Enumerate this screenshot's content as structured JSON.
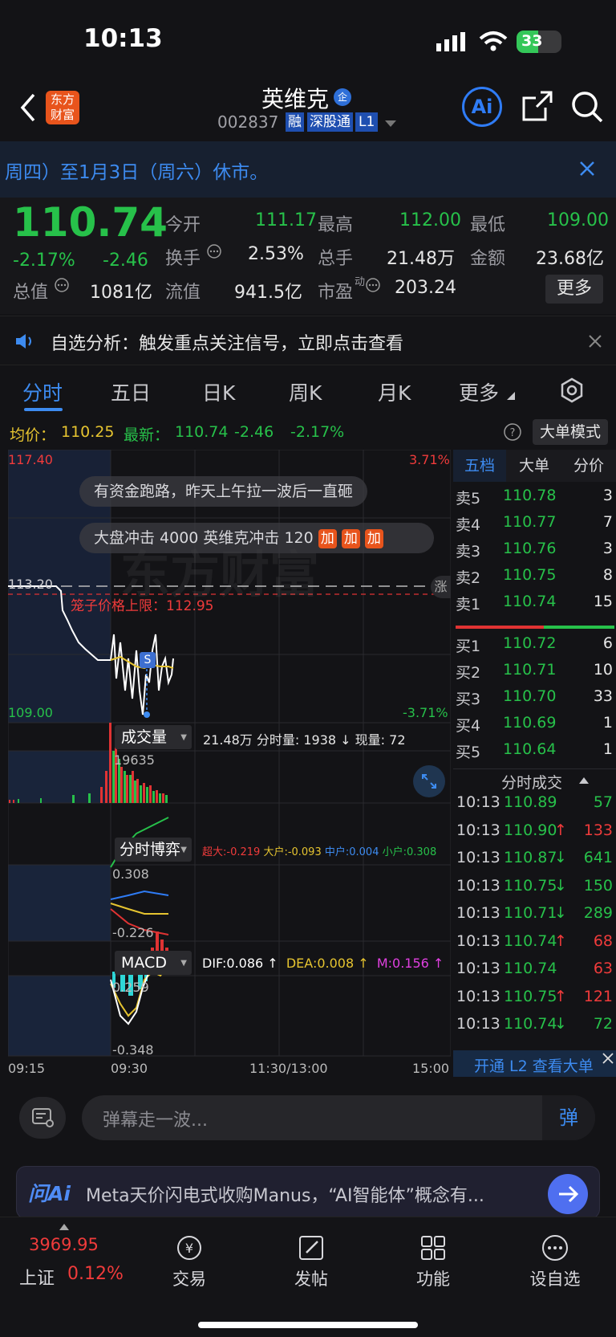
{
  "status": {
    "time": "10:13",
    "battery": "33"
  },
  "header": {
    "brand_top": "东方",
    "brand_bottom": "财富",
    "stock_name": "英维克",
    "stock_tag": "企",
    "code": "002837",
    "badges": [
      "融",
      "深股通",
      "L1"
    ]
  },
  "banner": {
    "text": "周四）至1月3日（周六）休市。"
  },
  "quote": {
    "price": "110.74",
    "pct": "-2.17%",
    "chg": "-2.46",
    "fields": [
      {
        "label": "今开",
        "value": "111.17"
      },
      {
        "label": "最高",
        "value": "112.00"
      },
      {
        "label": "最低",
        "value": "109.00"
      },
      {
        "label": "换手",
        "value": "2.53%"
      },
      {
        "label": "总手",
        "value": "21.48万"
      },
      {
        "label": "金额",
        "value": "23.68亿"
      },
      {
        "label": "总值",
        "value": "1081亿"
      },
      {
        "label": "流值",
        "value": "941.5亿"
      },
      {
        "label": "市盈",
        "value": "203.24",
        "sup": "动"
      }
    ],
    "more": "更多"
  },
  "notice": {
    "text": "自选分析：触发重点关注信号，立即点击查看"
  },
  "tabs": [
    "分时",
    "五日",
    "日K",
    "周K",
    "月K",
    "更多"
  ],
  "infobar": {
    "avg_label": "均价：",
    "avg": "110.25",
    "latest_label": "最新：",
    "latest": "110.74",
    "chg": "-2.46",
    "pct": "-2.17%",
    "mode": "大单模式"
  },
  "chart": {
    "top_price": "117.40",
    "top_pct": "3.71%",
    "mid_price": "113.20",
    "limit": "笼子价格上限：112.95",
    "bottom_price": "109.00",
    "bottom_pct": "-3.71%",
    "watermark": "东方财富",
    "mid_tag": "涨",
    "bullet1": "有资金跑路，昨天上午拉一波后一直砸",
    "bullet2": "大盘冲击 4000 英维克冲击 120",
    "bullet2_tags": [
      "加",
      "加",
      "加"
    ],
    "marker": "S"
  },
  "volume": {
    "title": "成交量",
    "stats": "21.48万 分时量: 1938 ↓ 现量: 72",
    "max": "19635"
  },
  "fund": {
    "title": "分时博弈",
    "chao": "超大:-0.219",
    "da": "大户:-0.093",
    "zhong": "中户:0.004",
    "xiao": "小户:0.308",
    "top": "0.308",
    "bottom": "-0.226"
  },
  "macd": {
    "title": "MACD",
    "dif": "DIF:0.086 ↑",
    "dea": "DEA:0.008 ↑",
    "m": "M:0.156 ↑",
    "top": "0.259",
    "bottom": "-0.348"
  },
  "xaxis": [
    "09:15",
    "09:30",
    "11:30/13:00",
    "15:00"
  ],
  "orderbook": {
    "tabs": [
      "五档",
      "大单",
      "分价"
    ],
    "asks": [
      {
        "l": "卖5",
        "p": "110.78",
        "v": "3"
      },
      {
        "l": "卖4",
        "p": "110.77",
        "v": "7"
      },
      {
        "l": "卖3",
        "p": "110.76",
        "v": "3"
      },
      {
        "l": "卖2",
        "p": "110.75",
        "v": "8"
      },
      {
        "l": "卖1",
        "p": "110.74",
        "v": "15"
      }
    ],
    "bids": [
      {
        "l": "买1",
        "p": "110.72",
        "v": "6"
      },
      {
        "l": "买2",
        "p": "110.71",
        "v": "10"
      },
      {
        "l": "买3",
        "p": "110.70",
        "v": "33"
      },
      {
        "l": "买4",
        "p": "110.69",
        "v": "1"
      },
      {
        "l": "买5",
        "p": "110.64",
        "v": "1"
      }
    ],
    "ticks_title": "分时成交",
    "ticks": [
      {
        "t": "10:13",
        "p": "110.89",
        "a": "",
        "v": "57",
        "c": "green"
      },
      {
        "t": "10:13",
        "p": "110.90",
        "a": "↑",
        "v": "133",
        "c": "red"
      },
      {
        "t": "10:13",
        "p": "110.87",
        "a": "↓",
        "v": "641",
        "c": "green"
      },
      {
        "t": "10:13",
        "p": "110.75",
        "a": "↓",
        "v": "150",
        "c": "green"
      },
      {
        "t": "10:13",
        "p": "110.71",
        "a": "↓",
        "v": "289",
        "c": "green"
      },
      {
        "t": "10:13",
        "p": "110.74",
        "a": "↑",
        "v": "68",
        "c": "red"
      },
      {
        "t": "10:13",
        "p": "110.74",
        "a": "",
        "v": "63",
        "c": "red"
      },
      {
        "t": "10:13",
        "p": "110.75",
        "a": "↑",
        "v": "121",
        "c": "red"
      },
      {
        "t": "10:13",
        "p": "110.74",
        "a": "↓",
        "v": "72",
        "c": "green"
      }
    ],
    "l2": "开通 L2 查看大单"
  },
  "danmu": {
    "placeholder": "弹幕走一波...",
    "send": "弹"
  },
  "ai": {
    "logo": "问Ai",
    "text": "Meta天价闪电式收购Manus，“AI智能体”概念有..."
  },
  "nav": {
    "index_value": "3969.95",
    "index_name": "上证",
    "index_pct": "0.12%",
    "items": [
      "交易",
      "发帖",
      "功能",
      "设自选"
    ]
  }
}
